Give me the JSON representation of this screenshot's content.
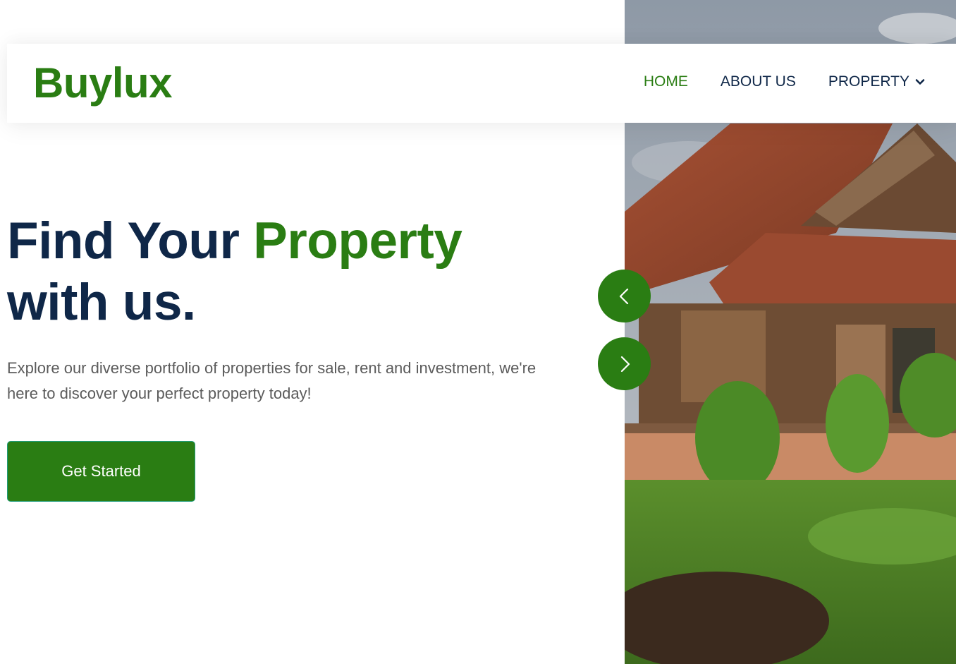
{
  "brand": {
    "logo_text": "Buylux",
    "accent_color": "#2a7d13",
    "dark_color": "#0f2748"
  },
  "nav": {
    "items": [
      {
        "label": "HOME",
        "active": true
      },
      {
        "label": "ABOUT US",
        "active": false
      },
      {
        "label": "PROPERTY",
        "active": false,
        "icon": "chevron-down-icon"
      }
    ]
  },
  "hero": {
    "headline_part1": "Find Your ",
    "headline_accent": "Property",
    "headline_part2": "with us.",
    "description": "Explore our diverse portfolio of properties for sale, rent and investment, we're here to discover your perfect property today!",
    "cta_label": "Get Started",
    "prev_icon": "chevron-left-icon",
    "next_icon": "chevron-right-icon",
    "image_subject": "rustic wooden house with terracotta tile roof surrounded by greenery"
  }
}
